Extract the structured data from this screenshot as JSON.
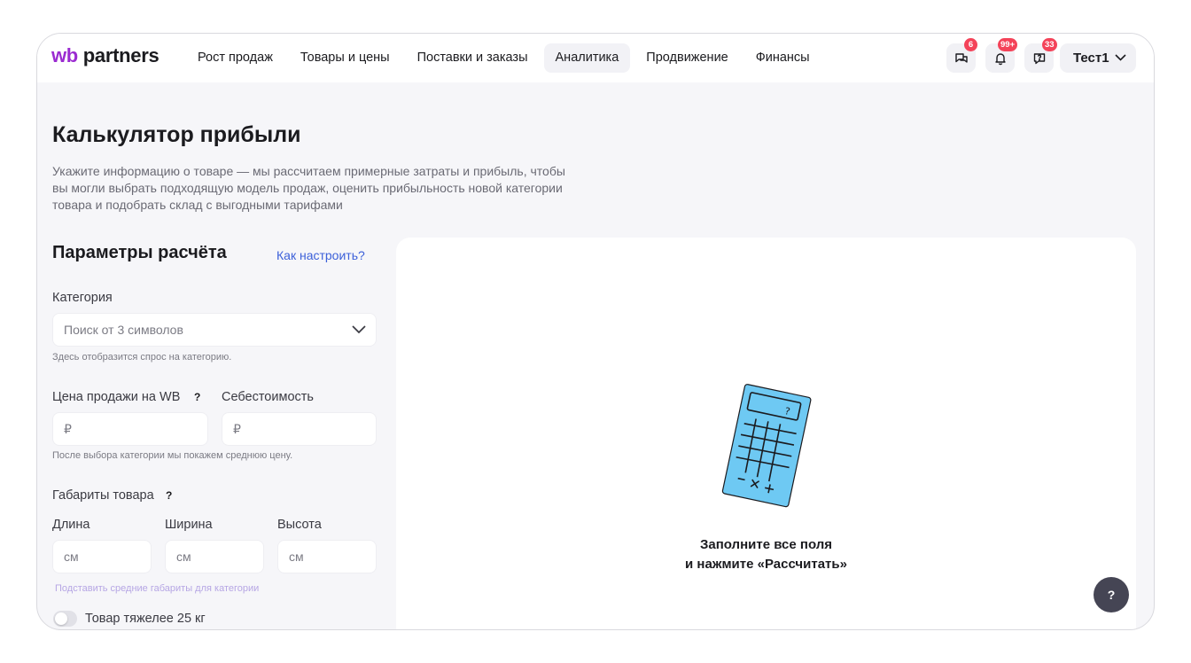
{
  "brand": {
    "prefix": "wb",
    "name": "partners",
    "accent": "#9b2bd1"
  },
  "nav": {
    "items": [
      {
        "label": "Рост продаж"
      },
      {
        "label": "Товары и цены"
      },
      {
        "label": "Поставки и заказы"
      },
      {
        "label": "Аналитика",
        "active": true
      },
      {
        "label": "Продвижение"
      },
      {
        "label": "Финансы"
      }
    ]
  },
  "header_icons": {
    "chat": {
      "icon": "chat-bubbles-icon",
      "badge": "6"
    },
    "notifications": {
      "icon": "bell-icon",
      "badge": "99+"
    },
    "support": {
      "icon": "question-bubble-icon",
      "badge": "33"
    }
  },
  "user": {
    "name": "Тест1"
  },
  "page": {
    "title": "Калькулятор прибыли",
    "subtitle": "Укажите информацию о товаре — мы рассчитаем примерные затраты и прибыль, чтобы вы могли выбрать подходящую модель продаж, оценить прибыльность новой категории товара и подобрать склад с выгодными тарифами"
  },
  "params": {
    "title": "Параметры расчёта",
    "help_link": "Как настроить?",
    "category": {
      "label": "Категория",
      "placeholder": "Поиск от 3 символов",
      "hint": "Здесь отобразится спрос на категорию."
    },
    "price": {
      "label": "Цена продажи на WB",
      "help": "?",
      "placeholder": "₽"
    },
    "cost": {
      "label": "Себестоимость",
      "placeholder": "₽"
    },
    "price_hint": "После выбора категории мы покажем среднюю цену.",
    "dimensions": {
      "label": "Габариты товара",
      "help": "?",
      "length": {
        "label": "Длина",
        "placeholder": "см"
      },
      "width": {
        "label": "Ширина",
        "placeholder": "см"
      },
      "height": {
        "label": "Высота",
        "placeholder": "см"
      },
      "autofill_link": "Подставить средние габариты для категории"
    },
    "heavy_toggle": {
      "label": "Товар тяжелее 25 кг",
      "checked": false
    }
  },
  "result": {
    "illustration": "calculator-illustration",
    "empty_line1": "Заполните все поля",
    "empty_line2": "и нажмите «Рассчитать»"
  },
  "help_fab": {
    "label": "?"
  }
}
